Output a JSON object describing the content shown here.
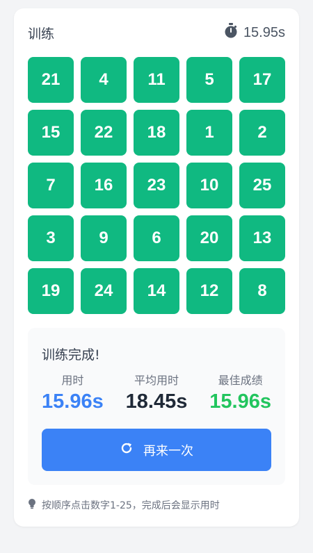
{
  "header": {
    "title": "训练",
    "timer_icon": "stopwatch-icon",
    "timer": "15.95s"
  },
  "grid": {
    "numbers": [
      "21",
      "4",
      "11",
      "5",
      "17",
      "15",
      "22",
      "18",
      "1",
      "2",
      "7",
      "16",
      "23",
      "10",
      "25",
      "3",
      "9",
      "6",
      "20",
      "13",
      "19",
      "24",
      "14",
      "12",
      "8"
    ],
    "tile_color": "#10b981"
  },
  "result": {
    "title": "训练完成!",
    "used_label": "用时",
    "used_value": "15.96s",
    "avg_label": "平均用时",
    "avg_value": "18.45s",
    "best_label": "最佳成绩",
    "best_value": "15.96s",
    "retry_icon": "refresh-icon",
    "retry_label": "再来一次"
  },
  "hint": {
    "icon": "lightbulb-icon",
    "text": "按顺序点击数字1-25，完成后会显示用时"
  },
  "colors": {
    "accent_blue": "#3b82f6",
    "accent_green": "#22c55e",
    "tile_green": "#10b981"
  }
}
